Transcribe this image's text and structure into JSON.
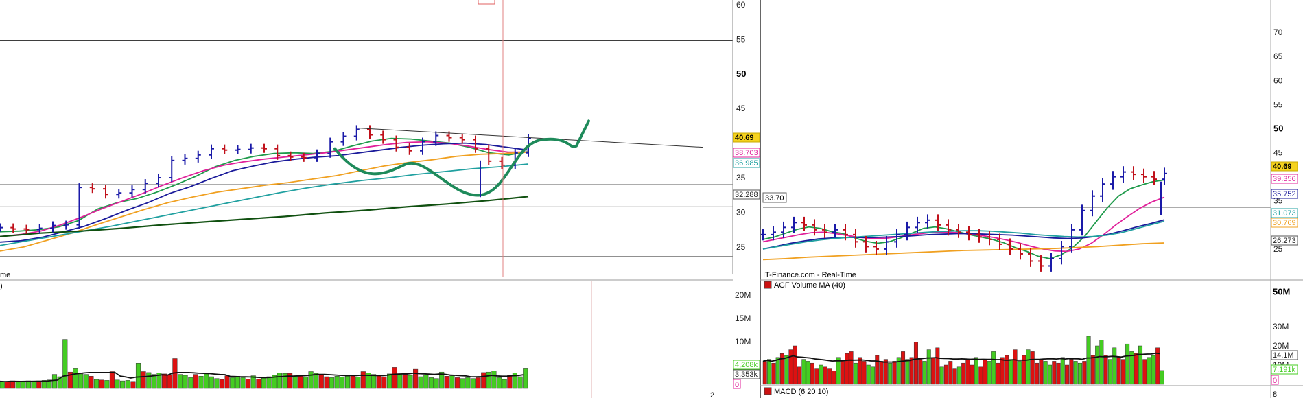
{
  "left_chart": {
    "price_axis_labels": [
      "60",
      "55",
      "50",
      "45",
      "35",
      "30",
      "25"
    ],
    "price_axis_bold": "50",
    "volume_axis_labels": [
      "20M",
      "15M",
      "10M"
    ],
    "truncated_panel_label": "me",
    "truncated_volume_label": ")",
    "truncated_bottom_label": "2",
    "value_tags": {
      "last_price": "40.69",
      "ma1": "38.703",
      "ma2": "36.985",
      "ma3": "32.288",
      "vol1": "4,208k",
      "vol2": "3,353k",
      "vol3": "0"
    }
  },
  "right_chart": {
    "price_axis_labels": [
      "70",
      "65",
      "60",
      "55",
      "45",
      "35",
      "25"
    ],
    "price_axis_bold": "50",
    "volume_axis_labels": [
      "50M",
      "30M",
      "20M",
      "10M"
    ],
    "volume_axis_bold": "50M",
    "macd_axis_label": "8",
    "line_label": "33.70",
    "source_label": "IT-Finance.com - Real-Time",
    "volume_panel_label": "AGF Volume   MA (40)",
    "macd_panel_label": "MACD (6 20 10)",
    "value_tags": {
      "last_price": "40.69",
      "ma1": "39.356",
      "ma2": "35.752",
      "ma3": "31.073",
      "ma4": "30.769",
      "ma5": "26.273",
      "vol1": "14.1M",
      "vol2": "7.191k",
      "vol3": "0"
    }
  },
  "colors": {
    "up_bar": "#1a1aa8",
    "down_bar": "#c0101a",
    "ma_green": "#1e9a4a",
    "ma_magenta": "#e0209a",
    "ma_blue": "#1a1a9a",
    "ma_orange": "#f0a020",
    "ma_teal": "#20a0a0",
    "ma_darkgreen": "#105010",
    "drawn_projection": "#1e8a5a",
    "vol_up": "#44cc22",
    "vol_down": "#dd1111",
    "price_tag_bg": "#f5d21e"
  },
  "chart_data": [
    {
      "type": "line",
      "description_source": "left price panel (OHLC bars with moving averages)",
      "y_unit": "price",
      "ylim": [
        23,
        60
      ],
      "series": [
        {
          "values": [
            27.8,
            27.6,
            27.5,
            27.7,
            28.1,
            28.2,
            33.6,
            33.4,
            32.6,
            32.8,
            33.3,
            34.2,
            35.0,
            37.5,
            37.8,
            38.3,
            39.2,
            39.0,
            39.1,
            39.3,
            39.2,
            38.2,
            38.0,
            37.9,
            38.5,
            40.2,
            41.0,
            42.0,
            41.2,
            40.5,
            39.4,
            38.9,
            40.2,
            41.1,
            40.8,
            40.5,
            39.2,
            37.4,
            36.8,
            38.6,
            40.69
          ]
        },
        {
          "values": [
            27.2,
            27.3,
            27.5,
            27.9,
            28.8,
            30.5,
            31.4,
            32.0,
            32.9,
            34.0,
            35.2,
            36.6,
            37.5,
            38.1,
            38.5,
            38.6,
            38.5,
            38.8,
            39.6,
            40.3,
            40.7,
            40.6,
            40.3,
            40.0,
            39.4,
            38.6,
            38.3,
            38.8
          ]
        },
        {
          "values": [
            26.5,
            26.8,
            27.3,
            28.2,
            29.3,
            30.5,
            31.6,
            32.7,
            33.9,
            35.0,
            36.0,
            36.8,
            37.3,
            37.7,
            38.0,
            38.3,
            38.6,
            39.0,
            39.4,
            39.8,
            40.1,
            40.2,
            40.0,
            39.6,
            39.1,
            38.7,
            38.703
          ]
        },
        {
          "values": [
            25.7,
            25.9,
            26.4,
            27.2,
            28.0,
            29.1,
            30.3,
            31.4,
            32.7,
            33.7,
            34.9,
            36.0,
            36.7,
            37.3,
            37.7,
            38.0,
            38.2,
            38.6,
            39.0,
            39.4,
            39.7,
            39.9,
            40.0,
            39.8,
            39.4,
            39.0
          ]
        },
        {
          "values": [
            24.4,
            25.0,
            26.0,
            27.0,
            28.2,
            29.3,
            30.4,
            31.4,
            32.2,
            32.9,
            33.4,
            33.9,
            34.3,
            34.8,
            35.3,
            36.0,
            36.7,
            37.2,
            37.6,
            38.1,
            38.4,
            38.5,
            38.7
          ]
        },
        {
          "values": [
            25.2,
            25.9,
            26.6,
            27.3,
            28.0,
            28.8,
            29.6,
            30.4,
            31.2,
            32.0,
            32.8,
            33.5,
            34.1,
            34.6,
            35.0,
            35.5,
            35.9,
            36.3,
            36.6,
            36.985
          ]
        },
        {
          "values": [
            26.5,
            27.0,
            27.3,
            27.7,
            28.2,
            28.6,
            29.0,
            29.4,
            29.9,
            30.3,
            30.8,
            31.2,
            31.7,
            32.288
          ]
        }
      ]
    },
    {
      "type": "bar",
      "description_source": "left volume panel",
      "y_unit": "volume (M)",
      "ylim": [
        0,
        20
      ],
      "values": [
        1.5,
        1.4,
        1.6,
        1.5,
        1.4,
        1.6,
        1.5,
        1.6,
        1.7,
        1.8,
        3.0,
        2.5,
        10.5,
        3.5,
        4.2,
        3.1,
        3.0,
        2.6,
        1.9,
        1.8,
        1.7,
        3.6,
        1.8,
        1.6,
        1.7,
        1.5,
        5.4,
        3.6,
        3.4,
        3.0,
        3.3,
        3.1,
        2.9,
        6.4,
        3.0,
        2.8,
        2.3,
        3.0,
        2.6,
        3.1,
        2.5,
        2.1,
        1.9,
        2.7,
        2.3,
        2.6,
        2.3,
        2.0,
        2.7,
        2.0,
        2.2,
        2.5,
        2.8,
        3.3,
        3.2,
        3.2,
        2.6,
        2.9,
        2.5,
        3.6,
        3.2,
        3.0,
        2.5,
        2.3,
        2.6,
        2.4,
        2.6,
        2.8,
        2.4,
        3.6,
        3.3,
        3.0,
        2.8,
        2.5,
        3.1,
        4.5,
        3.1,
        3.0,
        2.8,
        4.1,
        2.5,
        2.9,
        2.3,
        2.1,
        3.5,
        2.6,
        2.7,
        2.3,
        2.1,
        2.3,
        2.1,
        2.3,
        3.4,
        3.5,
        3.7,
        2.3,
        1.9,
        2.9,
        3.3,
        2.5,
        4.208
      ]
    },
    {
      "type": "line",
      "description_source": "right price panel (OHLC bars with moving averages)",
      "y_unit": "price",
      "ylim": [
        20,
        75
      ],
      "series": [
        {
          "values": [
            28.0,
            28.5,
            29.5,
            30.5,
            30.0,
            29.0,
            28.5,
            29.0,
            28.0,
            26.5,
            25.5,
            25.0,
            26.5,
            28.0,
            29.5,
            30.5,
            31.0,
            30.0,
            29.0,
            28.5,
            28.0,
            27.5,
            27.0,
            26.0,
            25.0,
            24.0,
            22.5,
            21.5,
            23.0,
            25.5,
            29.0,
            33.0,
            36.0,
            38.5,
            40.0,
            41.0,
            40.5,
            40.0,
            39.5,
            40.69
          ]
        },
        {
          "values": [
            27.0,
            27.5,
            28.3,
            29.1,
            29.6,
            29.3,
            28.6,
            28.2,
            27.3,
            26.6,
            26.2,
            26.5,
            27.3,
            28.3,
            29.3,
            29.6,
            29.2,
            28.6,
            28.0,
            27.5,
            27.0,
            26.3,
            25.3,
            24.5,
            23.5,
            23.0,
            23.8,
            25.3,
            27.5,
            30.5,
            33.5,
            36.0,
            37.5,
            38.3,
            39.0,
            39.356
          ]
        },
        {
          "values": [
            26.5,
            27.0,
            27.5,
            28.0,
            28.4,
            28.5,
            28.2,
            27.8,
            27.4,
            27.2,
            27.2,
            27.5,
            27.9,
            28.2,
            28.5,
            28.5,
            28.4,
            28.1,
            27.8,
            27.4,
            26.9,
            26.3,
            25.6,
            25.0,
            24.6,
            24.5,
            25.0,
            26.2,
            28.0,
            30.0,
            31.8,
            33.5,
            34.8,
            35.752
          ]
        },
        {
          "values": [
            25.0,
            25.6,
            26.2,
            26.7,
            27.1,
            27.3,
            27.4,
            27.4,
            27.4,
            27.5,
            27.6,
            27.8,
            28.0,
            28.1,
            28.2,
            28.2,
            28.1,
            28.0,
            27.9,
            27.7,
            27.5,
            27.3,
            27.2,
            27.3,
            27.6,
            28.1,
            28.8,
            29.6,
            30.3,
            31.073
          ]
        },
        {
          "values": [
            25.0,
            25.5,
            26.0,
            26.5,
            26.9,
            27.2,
            27.4,
            27.6,
            27.8,
            28.0,
            28.2,
            28.4,
            28.6,
            28.7,
            28.8,
            28.8,
            28.7,
            28.5,
            28.3,
            28.0,
            27.8,
            27.6,
            27.5,
            27.6,
            27.9,
            28.4,
            29.2,
            30.0,
            30.769
          ]
        },
        {
          "values": [
            22.8,
            23.0,
            23.3,
            23.5,
            23.7,
            23.9,
            24.1,
            24.3,
            24.5,
            24.7,
            24.8,
            24.9,
            25.0,
            25.1,
            25.3,
            25.5,
            25.8,
            26.1,
            26.273
          ]
        }
      ]
    },
    {
      "type": "bar",
      "description_source": "right volume panel",
      "y_unit": "volume (M)",
      "ylim": [
        0,
        50
      ],
      "values": [
        12,
        13,
        11,
        14,
        16,
        15,
        18,
        20,
        9,
        13,
        12,
        11,
        8,
        10,
        9,
        8,
        7,
        14,
        12,
        16,
        17,
        11,
        14,
        12,
        10,
        9,
        15,
        12,
        13,
        11,
        12,
        14,
        17,
        13,
        14,
        22,
        13,
        12,
        18,
        14,
        19,
        9,
        10,
        12,
        8,
        9,
        11,
        13,
        10,
        14,
        9,
        13,
        12,
        17,
        11,
        14,
        15,
        13,
        18,
        12,
        15,
        18,
        17,
        11,
        13,
        12,
        10,
        12,
        11,
        14,
        10,
        13,
        12,
        11,
        12,
        25,
        15,
        20,
        23,
        15,
        13,
        19,
        14,
        13,
        21,
        17,
        16,
        20,
        13,
        14,
        15,
        19,
        7.191
      ]
    }
  ]
}
